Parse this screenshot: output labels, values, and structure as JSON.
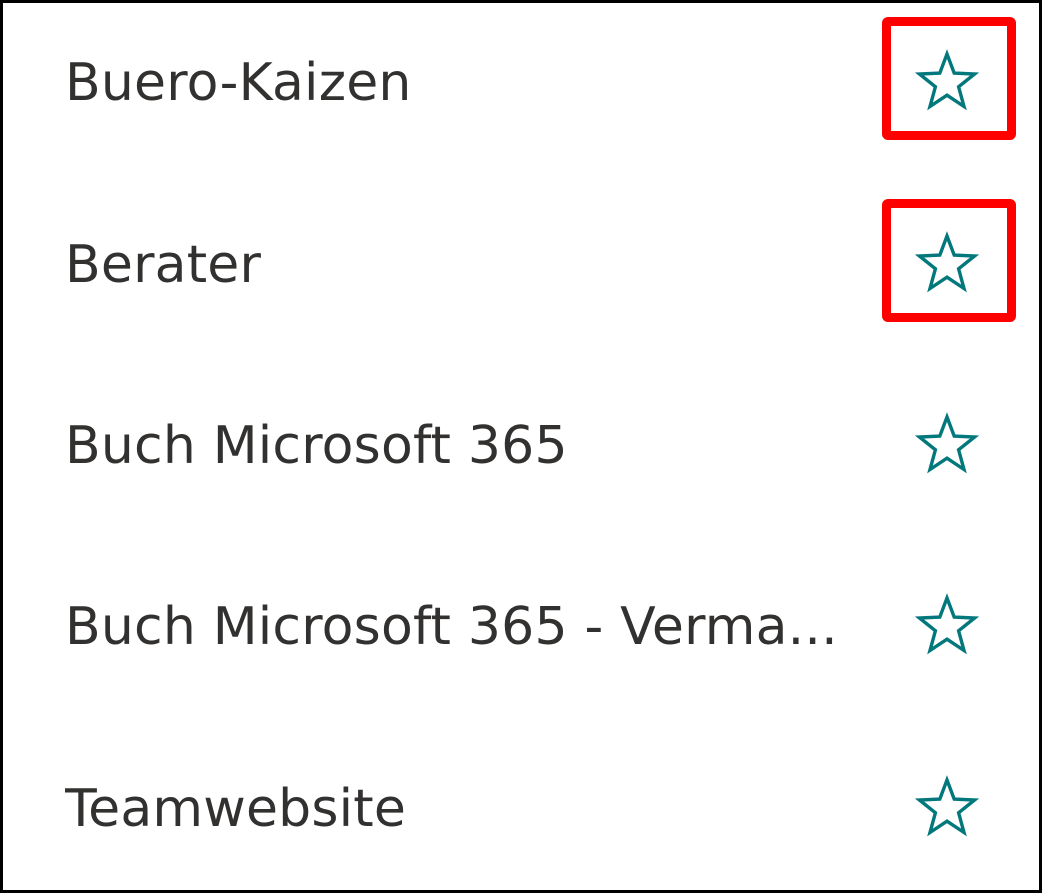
{
  "sites": [
    {
      "name": "Buero-Kaizen",
      "favorite_icon": "star-outline-icon",
      "highlighted": true
    },
    {
      "name": "Berater",
      "favorite_icon": "star-outline-icon",
      "highlighted": true
    },
    {
      "name": "Buch Microsoft 365",
      "favorite_icon": "star-outline-icon",
      "highlighted": false
    },
    {
      "name": "Buch Microsoft 365 - Verma...",
      "favorite_icon": "star-outline-icon",
      "highlighted": false
    },
    {
      "name": "Teamwebsite",
      "favorite_icon": "star-outline-icon",
      "highlighted": false
    }
  ],
  "colors": {
    "text": "#323130",
    "star": "#03787c",
    "highlight": "#ff0000",
    "frame": "#000000",
    "background": "#ffffff"
  }
}
